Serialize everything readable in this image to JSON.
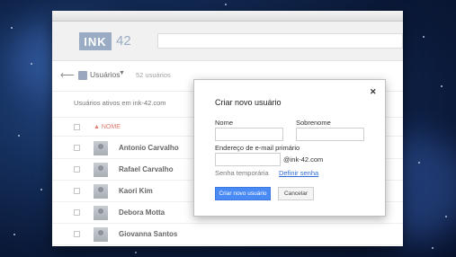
{
  "app": {
    "logo_text": "INK",
    "logo_number": "42"
  },
  "toolbar": {
    "users_label": "Usuários",
    "count_label": "52 usuários"
  },
  "list": {
    "active_label": "Usuários ativos em ink-42.com",
    "sort_label": "▲ NOME",
    "rows": [
      {
        "name": "Antonio Carvalho"
      },
      {
        "name": "Rafael Carvalho"
      },
      {
        "name": "Kaori Kim"
      },
      {
        "name": "Debora Motta"
      },
      {
        "name": "Giovanna Santos"
      }
    ]
  },
  "dialog": {
    "title": "Criar novo usuário",
    "first_name_label": "Nome",
    "last_name_label": "Sobrenome",
    "email_label": "Endereço de e-mail primário",
    "domain": "@ink-42.com",
    "temp_password": "Senha temporária",
    "set_password": "Definir senha",
    "create_button": "Criar novo usuário",
    "cancel_button": "Cancelar",
    "close_symbol": "✕"
  },
  "colors": {
    "accent": "#4a8af4",
    "logo": "#9aacc3",
    "sort": "#e07b6f",
    "link": "#2e6ad6"
  }
}
